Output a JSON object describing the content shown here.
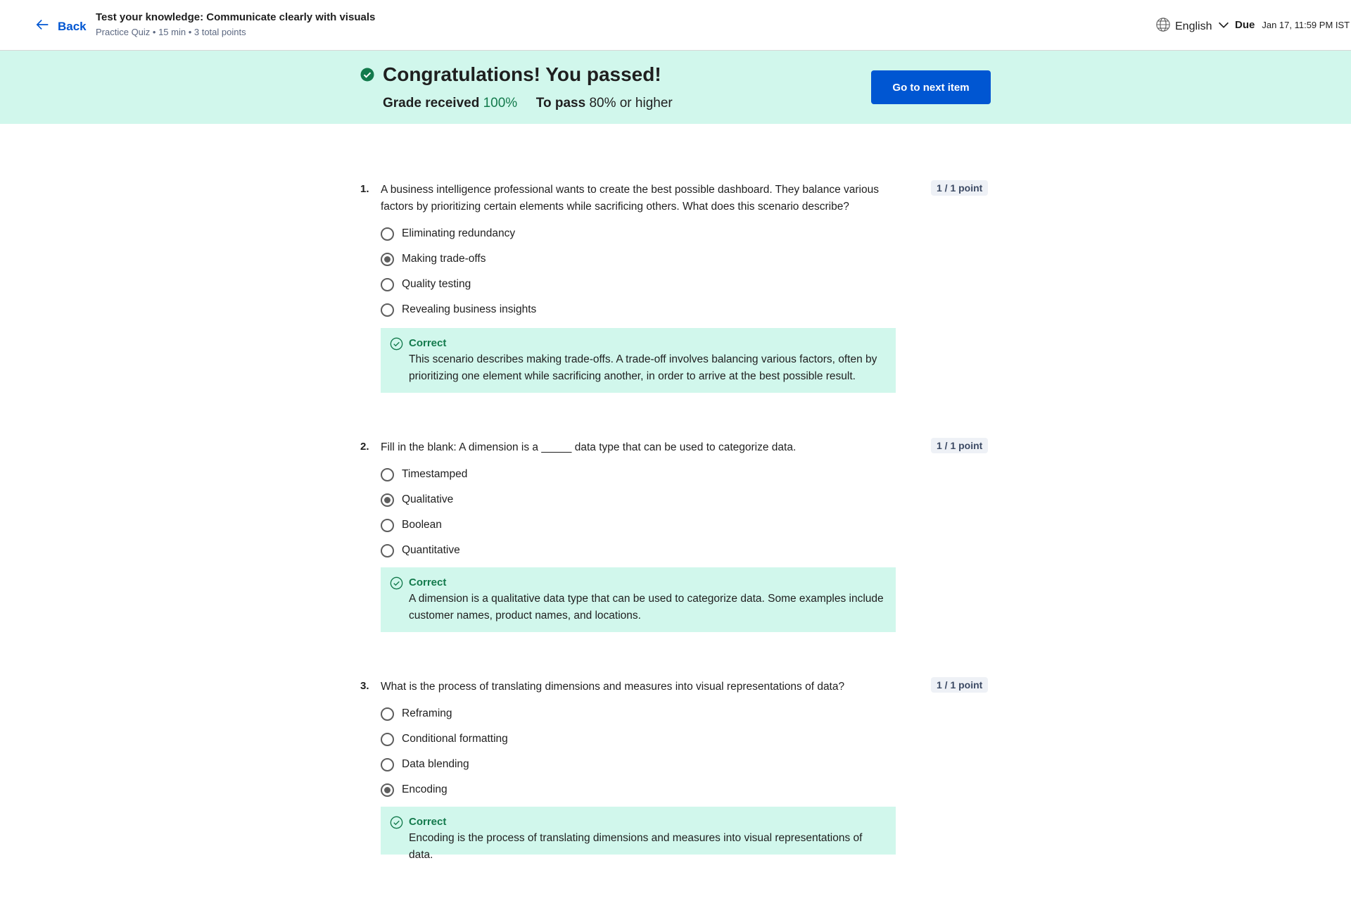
{
  "header": {
    "back_label": "Back",
    "title": "Test your knowledge: Communicate clearly with visuals",
    "subtitle": "Practice Quiz • 15 min • 3 total points",
    "language": "English",
    "due_label": "Due",
    "due_date": "Jan 17, 11:59 PM IST"
  },
  "banner": {
    "title": "Congratulations! You passed!",
    "grade_label": "Grade received",
    "grade_value": "100%",
    "pass_label": "To pass",
    "pass_value": "80% or higher",
    "next_button": "Go to next item"
  },
  "questions": [
    {
      "number": "1.",
      "text": "A business intelligence professional wants to create the best possible dashboard. They balance various factors by prioritizing certain elements while sacrificing others. What does this scenario describe?",
      "points": "1 / 1 point",
      "options": [
        "Eliminating redundancy",
        "Making trade-offs",
        "Quality testing",
        "Revealing business insights"
      ],
      "selected_index": 1,
      "feedback_title": "Correct",
      "feedback_text": "This scenario describes making trade-offs. A trade-off involves balancing various factors, often by prioritizing one element while sacrificing another, in order to arrive at the best possible result."
    },
    {
      "number": "2.",
      "text": "Fill in the blank: A dimension is a _____ data type that can be used to categorize data.",
      "points": "1 / 1 point",
      "options": [
        "Timestamped",
        "Qualitative",
        "Boolean",
        "Quantitative"
      ],
      "selected_index": 1,
      "feedback_title": "Correct",
      "feedback_text": "A dimension is a qualitative data type that can be used to categorize data. Some examples include customer names, product names, and locations."
    },
    {
      "number": "3.",
      "text": "What is the process of translating dimensions and measures into visual representations of data?",
      "points": "1 / 1 point",
      "options": [
        "Reframing",
        "Conditional formatting",
        "Data blending",
        "Encoding"
      ],
      "selected_index": 3,
      "feedback_title": "Correct",
      "feedback_text": "Encoding is the process of translating dimensions and measures into visual representations of data."
    }
  ],
  "colors": {
    "accent": "#0056d2",
    "success_bg": "#d1f7ec",
    "success_text": "#137a4c"
  },
  "icons": {
    "back": "arrow-left-icon",
    "language": "globe-icon",
    "language_dropdown": "chevron-down-icon",
    "passed": "check-circle-icon",
    "feedback": "check-circle-outline-icon"
  }
}
